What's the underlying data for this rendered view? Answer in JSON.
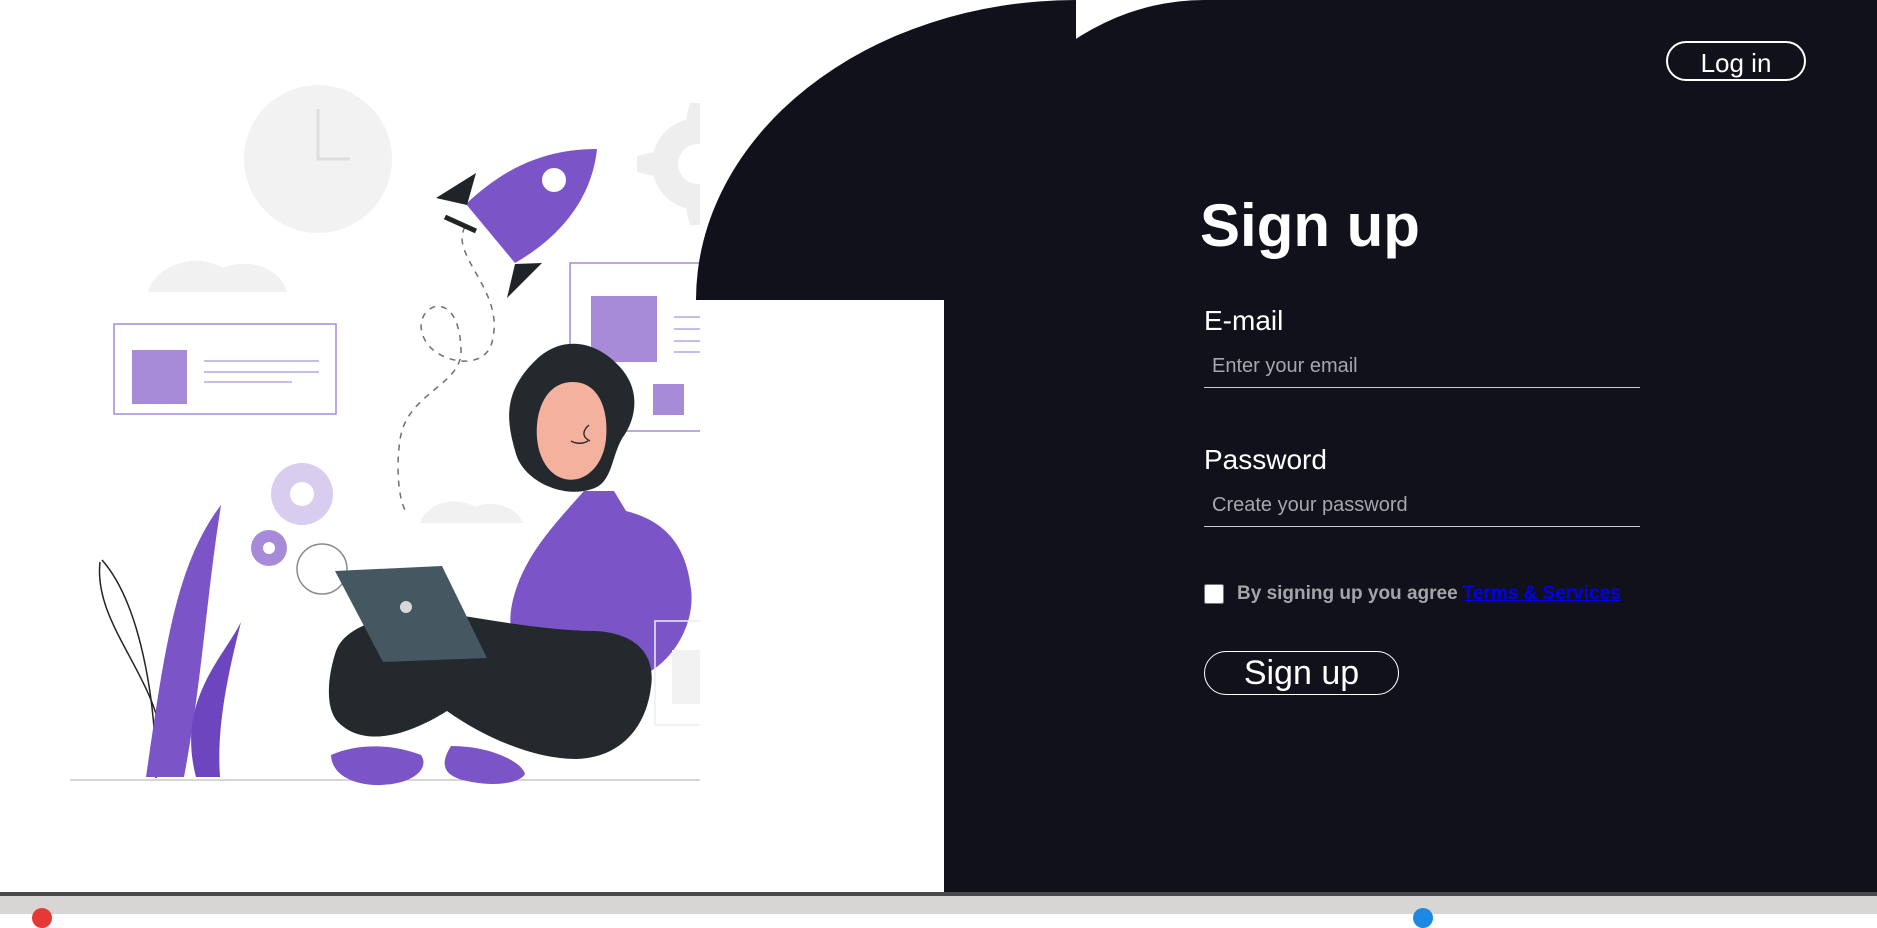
{
  "header": {
    "login_label": "Log in"
  },
  "form": {
    "title": "Sign up",
    "email_label": "E-mail",
    "email_placeholder": "Enter your email",
    "email_value": "",
    "password_label": "Password",
    "password_placeholder": "Create your password",
    "password_value": "",
    "agree_text": "By signing up you agree",
    "terms_link": "Terms & Services",
    "submit_label": "Sign up"
  },
  "colors": {
    "background": "#ffffff",
    "panel": "#11111b",
    "accent": "#7b55c7",
    "link": "#0000ee"
  },
  "illustration": {
    "icon_names": [
      "clock-icon",
      "gear-icon",
      "rocket-icon",
      "bar-chart-icon",
      "laptop-icon",
      "person-illustration"
    ]
  }
}
